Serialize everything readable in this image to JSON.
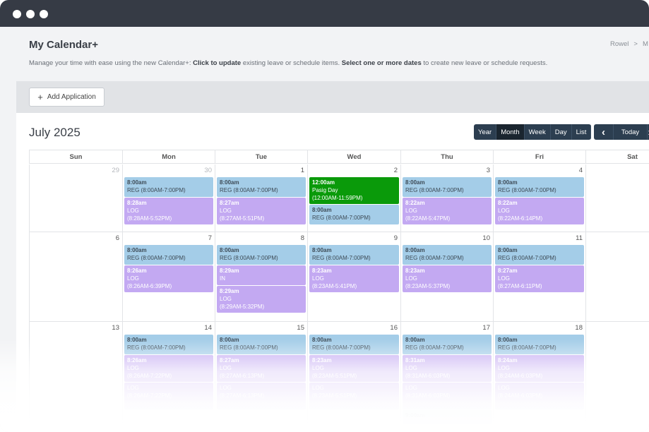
{
  "window": {
    "controls": [
      "close",
      "minimize",
      "maximize"
    ]
  },
  "header": {
    "title": "My Calendar+",
    "breadcrumb": [
      "Rowel",
      "M"
    ],
    "subtitle_parts": [
      {
        "text": "Manage your time with ease using the new Calendar+: ",
        "bold": false
      },
      {
        "text": "Click to update",
        "bold": true
      },
      {
        "text": " existing leave or schedule items. ",
        "bold": false
      },
      {
        "text": "Select one or more dates",
        "bold": true
      },
      {
        "text": " to create new leave or schedule requests.",
        "bold": false
      }
    ]
  },
  "toolbar": {
    "add_label": "Add Application"
  },
  "calendar": {
    "month_title": "July 2025",
    "views": [
      "Year",
      "Month",
      "Week",
      "Day",
      "List"
    ],
    "active_view": "Month",
    "nav": {
      "prev": "‹",
      "today": "Today",
      "next": "›"
    },
    "weekdays": [
      "Sun",
      "Mon",
      "Tue",
      "Wed",
      "Thu",
      "Fri",
      "Sat"
    ],
    "colors": {
      "reg": "#a4cde8",
      "log": "#c3a9f2",
      "holiday": "#0a9a0a"
    },
    "weeks": [
      [
        {
          "day": "29",
          "other": true,
          "events": []
        },
        {
          "day": "30",
          "other": true,
          "events": [
            {
              "type": "reg",
              "time": "8:00am",
              "lines": [
                "REG (8:00AM-7:00PM)"
              ]
            },
            {
              "type": "log",
              "time": "8:28am",
              "lines": [
                "LOG",
                "(8:28AM-5:52PM)"
              ]
            }
          ]
        },
        {
          "day": "1",
          "events": [
            {
              "type": "reg",
              "time": "8:00am",
              "lines": [
                "REG (8:00AM-7:00PM)"
              ]
            },
            {
              "type": "log",
              "time": "8:27am",
              "lines": [
                "LOG",
                "(8:27AM-5:51PM)"
              ]
            }
          ]
        },
        {
          "day": "2",
          "events": [
            {
              "type": "holiday",
              "time": "12:00am",
              "lines": [
                "Pasig Day",
                "(12:00AM-11:59PM)"
              ]
            },
            {
              "type": "reg",
              "time": "8:00am",
              "lines": [
                "REG (8:00AM-7:00PM)"
              ]
            }
          ]
        },
        {
          "day": "3",
          "events": [
            {
              "type": "reg",
              "time": "8:00am",
              "lines": [
                "REG (8:00AM-7:00PM)"
              ]
            },
            {
              "type": "log",
              "time": "8:22am",
              "lines": [
                "LOG",
                "(8:22AM-5:47PM)"
              ]
            }
          ]
        },
        {
          "day": "4",
          "events": [
            {
              "type": "reg",
              "time": "8:00am",
              "lines": [
                "REG (8:00AM-7:00PM)"
              ]
            },
            {
              "type": "log",
              "time": "8:22am",
              "lines": [
                "LOG",
                "(8:22AM-6:14PM)"
              ]
            }
          ]
        },
        {
          "day": "",
          "events": []
        }
      ],
      [
        {
          "day": "6",
          "events": []
        },
        {
          "day": "7",
          "events": [
            {
              "type": "reg",
              "time": "8:00am",
              "lines": [
                "REG (8:00AM-7:00PM)"
              ]
            },
            {
              "type": "log",
              "time": "8:26am",
              "lines": [
                "LOG",
                "(8:26AM-6:39PM)"
              ]
            }
          ]
        },
        {
          "day": "8",
          "events": [
            {
              "type": "reg",
              "time": "8:00am",
              "lines": [
                "REG (8:00AM-7:00PM)"
              ]
            },
            {
              "type": "log",
              "time": "8:29am",
              "lines": [
                "IN"
              ]
            },
            {
              "type": "log",
              "time": "8:29am",
              "lines": [
                "LOG",
                "(8:29AM-5:32PM)"
              ]
            }
          ]
        },
        {
          "day": "9",
          "events": [
            {
              "type": "reg",
              "time": "8:00am",
              "lines": [
                "REG (8:00AM-7:00PM)"
              ]
            },
            {
              "type": "log",
              "time": "8:23am",
              "lines": [
                "LOG",
                "(8:23AM-5:41PM)"
              ]
            }
          ]
        },
        {
          "day": "10",
          "events": [
            {
              "type": "reg",
              "time": "8:00am",
              "lines": [
                "REG (8:00AM-7:00PM)"
              ]
            },
            {
              "type": "log",
              "time": "8:23am",
              "lines": [
                "LOG",
                "(8:23AM-5:37PM)"
              ]
            }
          ]
        },
        {
          "day": "11",
          "events": [
            {
              "type": "reg",
              "time": "8:00am",
              "lines": [
                "REG (8:00AM-7:00PM)"
              ]
            },
            {
              "type": "log",
              "time": "8:27am",
              "lines": [
                "LOG",
                "(8:27AM-6:11PM)"
              ]
            }
          ]
        },
        {
          "day": "",
          "events": []
        }
      ],
      [
        {
          "day": "13",
          "events": []
        },
        {
          "day": "14",
          "events": [
            {
              "type": "reg",
              "time": "8:00am",
              "lines": [
                "REG (8:00AM-7:00PM)"
              ]
            },
            {
              "type": "log",
              "time": "8:26am",
              "lines": [
                "LOG",
                "(8:26AM-7:22PM)"
              ]
            },
            {
              "type": "log",
              "time": "",
              "lines": [
                "LOG",
                "(8:26AM-7:22PM)"
              ]
            }
          ]
        },
        {
          "day": "15",
          "events": [
            {
              "type": "reg",
              "time": "8:00am",
              "lines": [
                "REG (8:00AM-7:00PM)"
              ]
            },
            {
              "type": "log",
              "time": "8:27am",
              "lines": [
                "LOG",
                "(8:27AM-6:13PM)"
              ]
            },
            {
              "type": "log",
              "time": "",
              "lines": [
                "LOG",
                "(8:27AM-6:13PM)"
              ]
            }
          ]
        },
        {
          "day": "16",
          "events": [
            {
              "type": "reg",
              "time": "8:00am",
              "lines": [
                "REG (8:00AM-7:00PM)"
              ]
            },
            {
              "type": "log",
              "time": "8:23am",
              "lines": [
                "LOG",
                "(8:23AM-5:51PM)"
              ]
            },
            {
              "type": "log",
              "time": "",
              "lines": [
                "LOG",
                "(8:23AM-5:51PM)"
              ]
            }
          ]
        },
        {
          "day": "17",
          "events": [
            {
              "type": "reg",
              "time": "8:00am",
              "lines": [
                "REG (8:00AM-7:00PM)"
              ]
            },
            {
              "type": "log",
              "time": "8:31am",
              "lines": [
                "LOG",
                "(8:31AM-6:03PM)"
              ]
            },
            {
              "type": "log",
              "time": "",
              "lines": [
                "LOG",
                "(8:31AM-6:03PM)"
              ]
            },
            {
              "type": "reg",
              "time": "9:00am",
              "lines": []
            }
          ]
        },
        {
          "day": "18",
          "events": [
            {
              "type": "reg",
              "time": "8:00am",
              "lines": [
                "REG (8:00AM-7:00PM)"
              ]
            },
            {
              "type": "log",
              "time": "8:24am",
              "lines": [
                "LOG",
                "(8:24AM-6:03PM)"
              ]
            },
            {
              "type": "log",
              "time": "",
              "lines": [
                "LOG",
                "(8:24AM-6:03PM)"
              ]
            }
          ]
        },
        {
          "day": "",
          "events": []
        }
      ]
    ]
  }
}
